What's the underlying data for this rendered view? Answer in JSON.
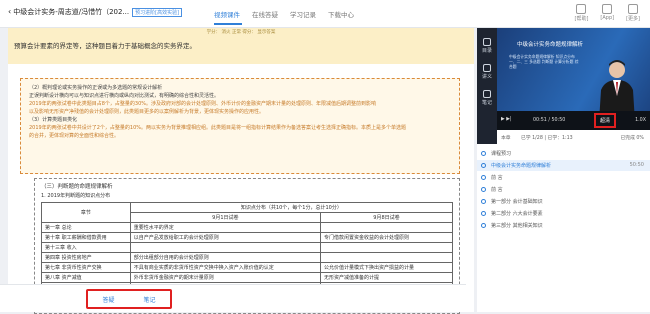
{
  "header": {
    "back_title": "中级会计实务-周志道/冯惜竹（202...",
    "back_tag": "预习进阶[高效实验]",
    "tabs": [
      "视频课件",
      "在线答疑",
      "学习记录",
      "下载中心"
    ],
    "icons": [
      {
        "name": "help",
        "label": "[帮助]"
      },
      {
        "name": "app",
        "label": "[App]"
      },
      {
        "name": "more",
        "label": "[更多]"
      }
    ]
  },
  "doc": {
    "note_text": "预算会计要素的界定等，这种题目着力于基础概念的实务界定。",
    "meta": "学分：  消火   正常  得分：                   显示答案",
    "sec_lines": [
      {
        "t": "（2）概判理论或实务操作的正误或为多选题的常规设计解析",
        "c": "h"
      },
      {
        "t": "正误判断设计横向可以与知识点进行横向或纵向对比测试，有明确的综合性和灵活性。",
        "c": "h"
      },
      {
        "t": "2019年的两张试卷中此类题目占8个，占整量的30%。涉及政府对部的会计处理原则、外币计价的金融资产期末计量的处理原则、年限减值后期调整前到影响",
        "c": "o"
      },
      {
        "t": "以及影响无形资产净残值的会计处理原则，此类题目更多的以案例解析为背景，更体现实务操作的应用性。",
        "c": "o"
      },
      {
        "t": "（3）计算类题目类化",
        "c": "h"
      },
      {
        "t": "2019年的两张试卷中共设计了2个，占整量的10%。两以实务为背景推理相应组。此类题目是将一组指标计算结果作为备选答案让考生选择正确指标。本质上是多个单选题",
        "c": "o"
      },
      {
        "t": "的合并，更体现对算的全面性和综合性。",
        "c": "o"
      }
    ],
    "table_caption": "（三）判断题的命题规律解析",
    "table_subcaption": "1. 2019年判断题的知识点分布",
    "table_header_main": "章节",
    "table_header_group": "知识点分布（共10个，每个1分，总计10分）",
    "table_header_cols": [
      "9月1日试卷",
      "9月8日试卷"
    ],
    "rows": [
      [
        "第一章  总论",
        "重要性水平的界定",
        ""
      ],
      [
        "第十章  职工薪酬和借款费用",
        "以自产产品发放给职工的会计处理原则",
        "专门借款闲置资金收益的会计处理原则"
      ],
      [
        "第十三章  收入",
        "",
        ""
      ],
      [
        "第四章  投资性房地产",
        "部分出租部分自用的会计处理原则",
        ""
      ],
      [
        "第七章  非货币性资产交换",
        "不具有商业实质的非货币性资产交换中换入资产入账价值的认定",
        "公允价值计量模式下换出资产损益的计量"
      ],
      [
        "第八章  资产减值",
        "外币非货币金融资产的期末计量原则",
        "无形资产减值准备的计提"
      ],
      [
        "第十二章  或有事项",
        "",
        "存在标的资产的亏损合同的会计处理原则"
      ],
      [
        "第二章  存货",
        "存货跌价准备的转回原则",
        "商贸企业采购环节的运输费的会计处理原则"
      ]
    ]
  },
  "bottom": {
    "qa": "答疑",
    "notes": "笔记"
  },
  "side_icons": [
    "目录",
    "讲义",
    "笔记"
  ],
  "video": {
    "title": "中级会计实务命题规律解析",
    "sub": "中级会计实务命题规律解析 知识点分布 一、二、三 多选题 判断题 计算分析题 综合题",
    "time": "00:51 / 50:50",
    "quality": "超清",
    "rate": "1.0X"
  },
  "playlist_header": {
    "a": "本章",
    "b": "已学 1/28 | 已学：1:13",
    "c": "已完成 0%"
  },
  "playlist": [
    {
      "label": "课程预习",
      "dur": "",
      "cur": false
    },
    {
      "label": "中级会计实务命题规律解析",
      "dur": "50:50",
      "cur": true
    },
    {
      "label": "前  言",
      "dur": "",
      "cur": false
    },
    {
      "label": "前  言",
      "dur": "",
      "cur": false
    },
    {
      "label": "第一部分  会计基础知识",
      "dur": "",
      "cur": false
    },
    {
      "label": "第二部分  六大会计要素",
      "dur": "",
      "cur": false
    },
    {
      "label": "第三部分  其他相关知识",
      "dur": "",
      "cur": false
    }
  ]
}
